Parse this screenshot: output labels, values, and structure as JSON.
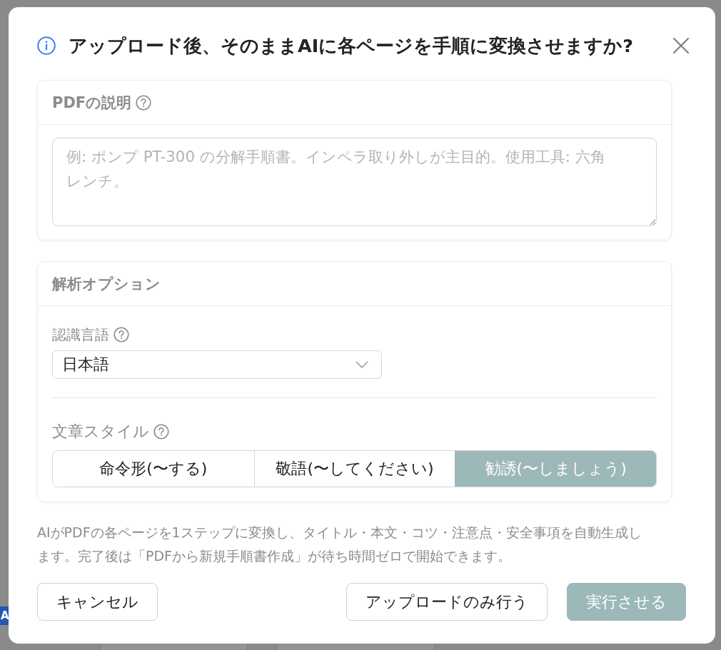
{
  "background": {
    "tab_label": "A"
  },
  "dialog": {
    "title": "アップロード後、そのままAIに各ページを手順に変換させますか?",
    "description_section": {
      "title": "PDFの説明",
      "placeholder": "例: ポンプ PT-300 の分解手順書。インペラ取り外しが主目的。使用工具: 六角レンチ。"
    },
    "analysis_section": {
      "title": "解析オプション",
      "language": {
        "label": "認識言語",
        "value": "日本語"
      },
      "writing_style": {
        "label": "文章スタイル",
        "options": [
          {
            "label": "命令形(〜する)",
            "selected": false
          },
          {
            "label": "敬語(〜してください)",
            "selected": false
          },
          {
            "label": "勧誘(〜しましょう)",
            "selected": true
          }
        ]
      }
    },
    "note": "AIがPDFの各ページを1ステップに変換し、タイトル・本文・コツ・注意点・安全事項を自動生成します。完了後は「PDFから新規手順書作成」が待ち時間ゼロで開始できます。",
    "buttons": [
      {
        "label": "キャンセル",
        "kind": "secondary"
      },
      {
        "label": "アップロードのみ行う",
        "kind": "secondary"
      },
      {
        "label": "実行させる",
        "kind": "primary"
      }
    ]
  }
}
